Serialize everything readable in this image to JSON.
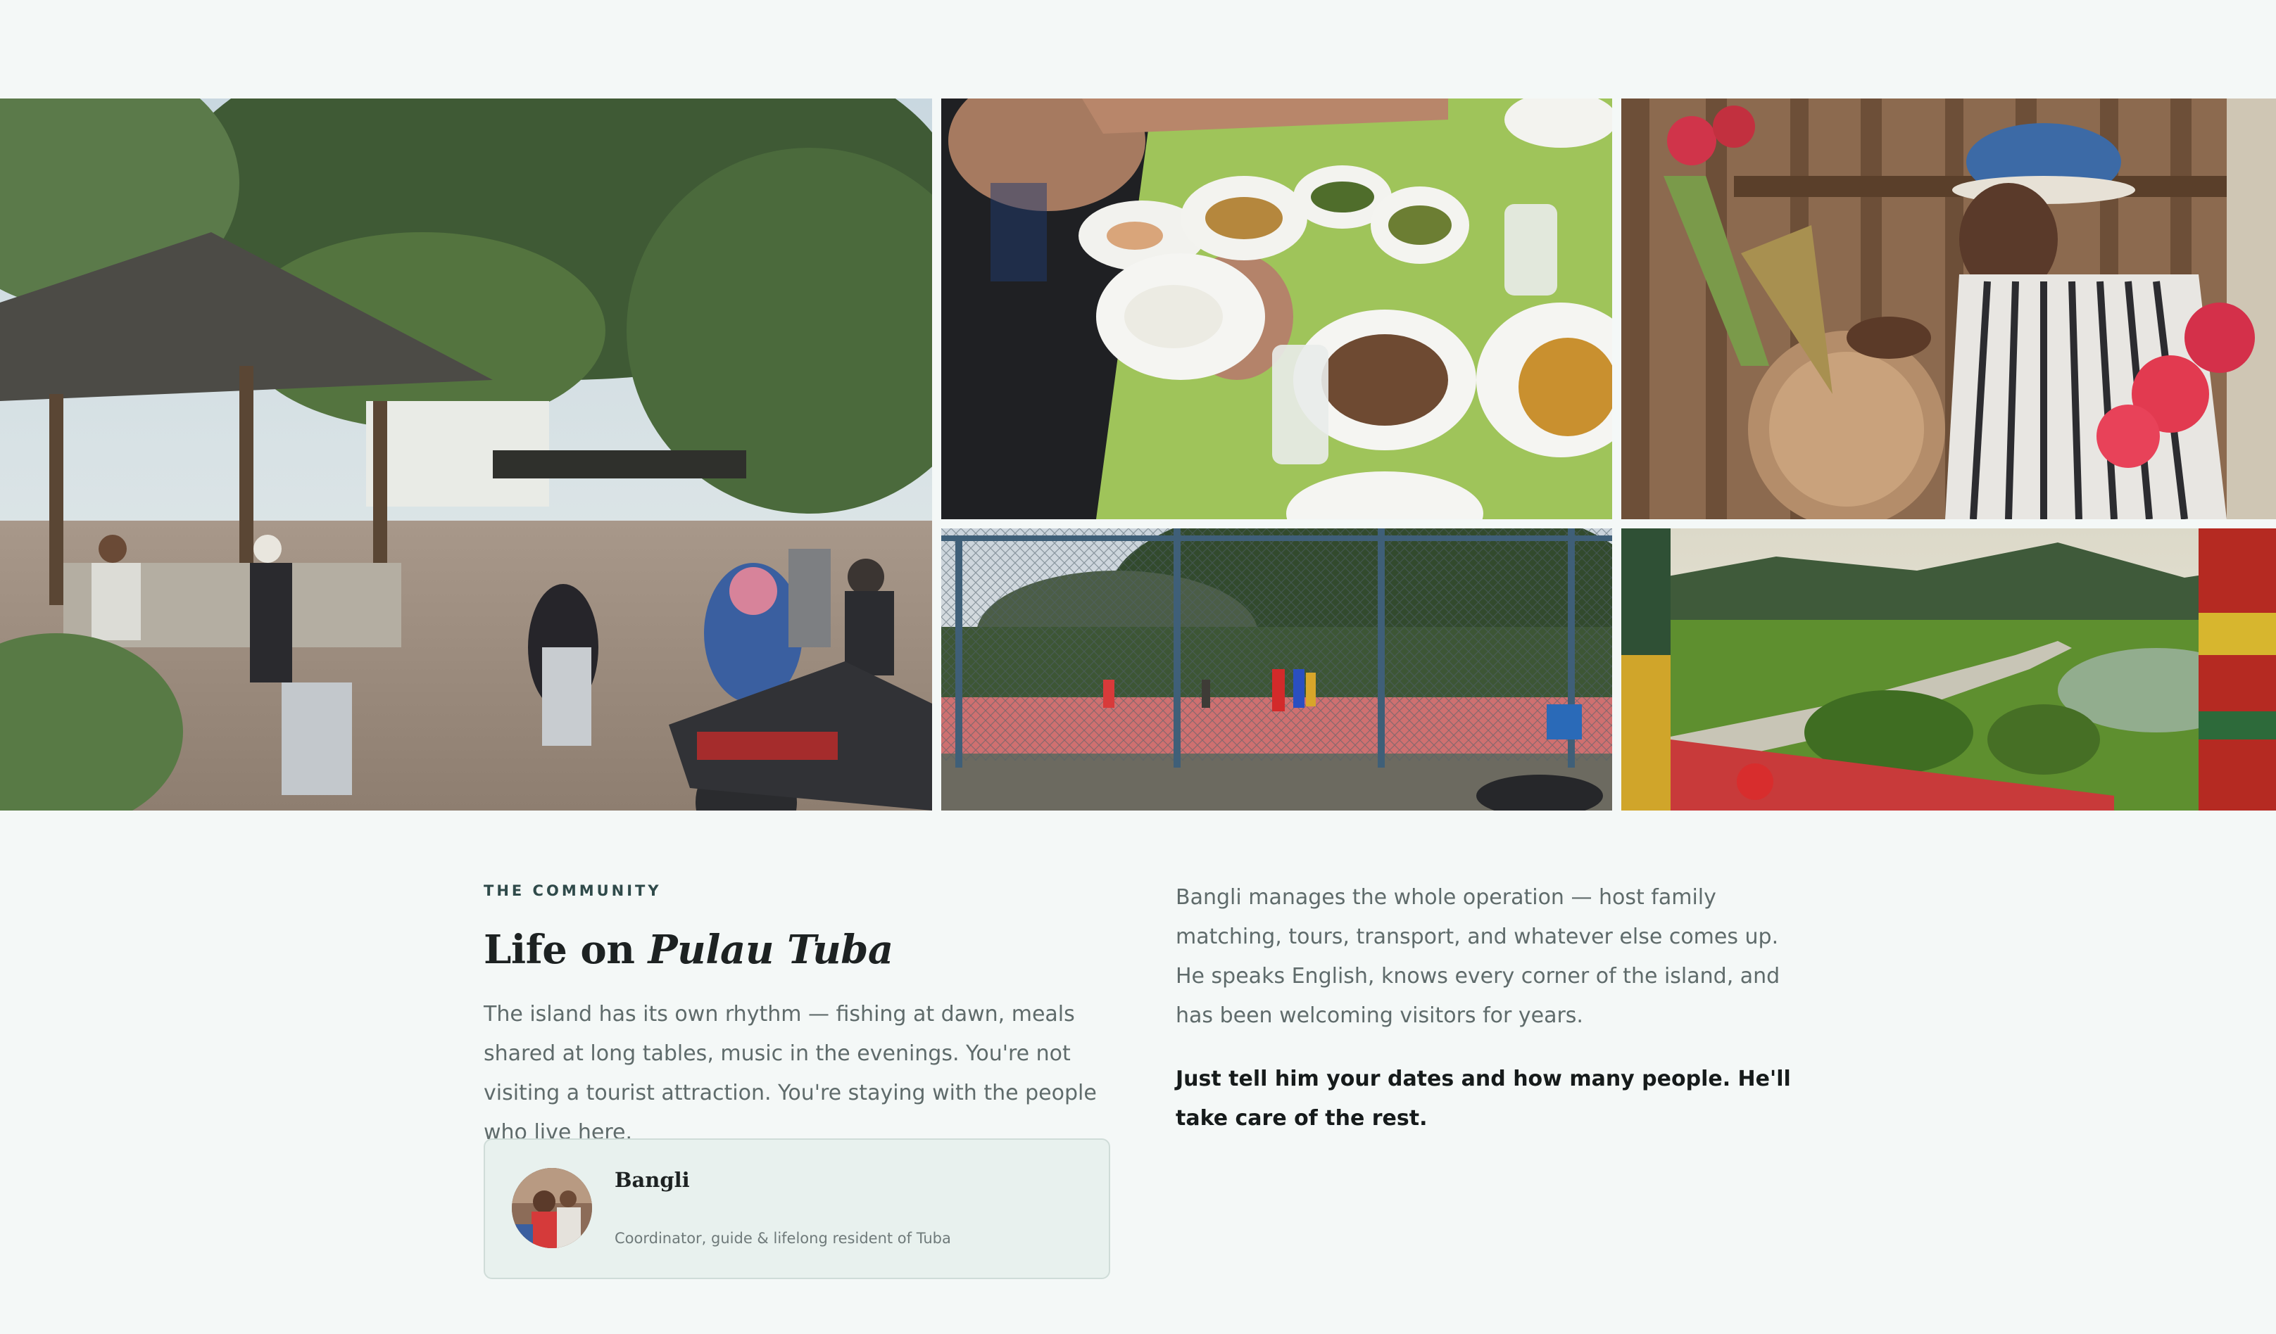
{
  "gallery": {
    "photos": [
      {
        "name": "village-gathering"
      },
      {
        "name": "shared-meal"
      },
      {
        "name": "drummer"
      },
      {
        "name": "football-court"
      },
      {
        "name": "rice-field-view"
      }
    ]
  },
  "community": {
    "eyebrow": "THE COMMUNITY",
    "title_plain": "Life on ",
    "title_italic": "Pulau Tuba",
    "lead": "The island has its own rhythm — fishing at dawn, meals shared at long tables, music in the evenings. You're not visiting a tourist attraction. You're staying with the people who live here.",
    "host": {
      "name": "Bangli",
      "role": "Coordinator, guide & lifelong resident of Tuba"
    },
    "body": "Bangli manages the whole operation — host family matching, tours, transport, and whatever else comes up. He speaks English, knows every corner of the island, and has been welcoming visitors for years.",
    "cta": "Just tell him your dates and how many people. He'll take care of the rest."
  },
  "colors": {
    "background": "#f4f8f7",
    "card": "#e8f1ee",
    "heading": "#1d2222",
    "muted_text": "#5f6b6b"
  }
}
